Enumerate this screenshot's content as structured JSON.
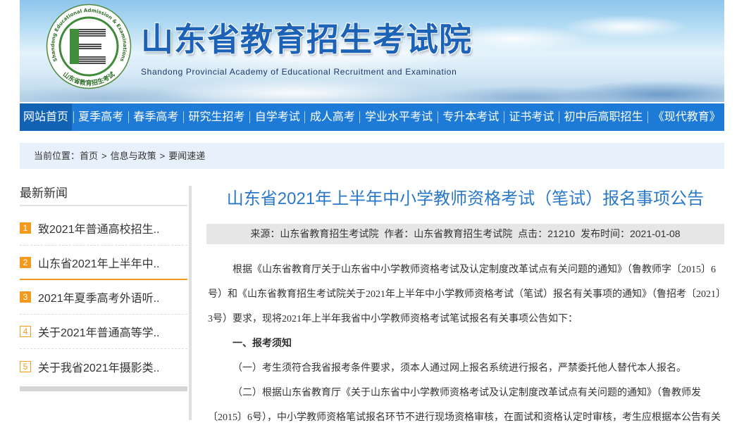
{
  "header": {
    "logo": {
      "ring_text_en": "Shandong Educational Admission & Examinations",
      "ring_text_cn": "山东省教育招生考试"
    },
    "title": "山东省教育招生考试院",
    "subtitle": "Shandong Provincial Academy of Educational Recruitment and Examination"
  },
  "nav": {
    "items": [
      {
        "label": "网站首页",
        "active": true
      },
      {
        "label": "夏季高考"
      },
      {
        "label": "春季高考"
      },
      {
        "label": "研究生招考"
      },
      {
        "label": "自学考试"
      },
      {
        "label": "成人高考"
      },
      {
        "label": "学业水平考试"
      },
      {
        "label": "专升本考试"
      },
      {
        "label": "证书考试"
      },
      {
        "label": "初中后高职招生"
      },
      {
        "label": "《现代教育》"
      }
    ]
  },
  "breadcrumb": {
    "prefix": "当前位置：",
    "separator": ">",
    "items": [
      "首页",
      "信息与政策",
      "要闻速递"
    ]
  },
  "sidebar": {
    "title": "最新新闻",
    "items": [
      {
        "index": "1",
        "title": "致2021年普通高校招生..",
        "highlight": true
      },
      {
        "index": "2",
        "title": "山东省2021年上半年中..",
        "highlight": true,
        "selected": true
      },
      {
        "index": "3",
        "title": "2021年夏季高考外语听..",
        "highlight": true
      },
      {
        "index": "4",
        "title": "关于2021年普通高等学..",
        "highlight": false
      },
      {
        "index": "5",
        "title": "关于我省2021年摄影类..",
        "highlight": false
      }
    ]
  },
  "article": {
    "title": "山东省2021年上半年中小学教师资格考试（笔试）报名事项公告",
    "meta": {
      "source_label": "来源：",
      "source": "山东省教育招生考试院",
      "author_label": "作者：",
      "author": "山东省教育招生考试院",
      "clicks_label": "点击：",
      "clicks": "21210",
      "date_label": "发布时间：",
      "date": "2021-01-08"
    },
    "body": {
      "intro": "根据《山东省教育厅关于山东省中小学教师资格考试及认定制度改革试点有关问题的通知》（鲁教师字〔2015〕6号）和《山东省教育招生考试院关于2021年上半年中小学教师资格考试（笔试）报名有关事项的通知》（鲁招考〔2021〕3号）要求，现将2021年上半年我省中小学教师资格考试笔试报名有关事项公告如下：",
      "section_1_heading": "一、报考须知",
      "item_1": "（一）考生须符合我省报考条件要求，须本人通过网上报名系统进行报名，严禁委托他人替代本人报名。",
      "item_2": "（二）根据山东省教育厅《关于山东省中小学教师资格考试及认定制度改革试点有关问题的通知》（鲁教师发〔2015〕6号），中小学教师资格笔试报名环节不进行现场资格审核，在面试和资格认定时审核，考生应根据本公告有关"
    }
  },
  "colors": {
    "nav_bg": "#1d7bd7",
    "nav_active_bg": "#1262b3",
    "title_blue": "#2a78c8",
    "accent_orange": "#f39a1e",
    "breadcrumb_bg": "#e7f1fb",
    "meta_bg": "#e6e6e6"
  }
}
